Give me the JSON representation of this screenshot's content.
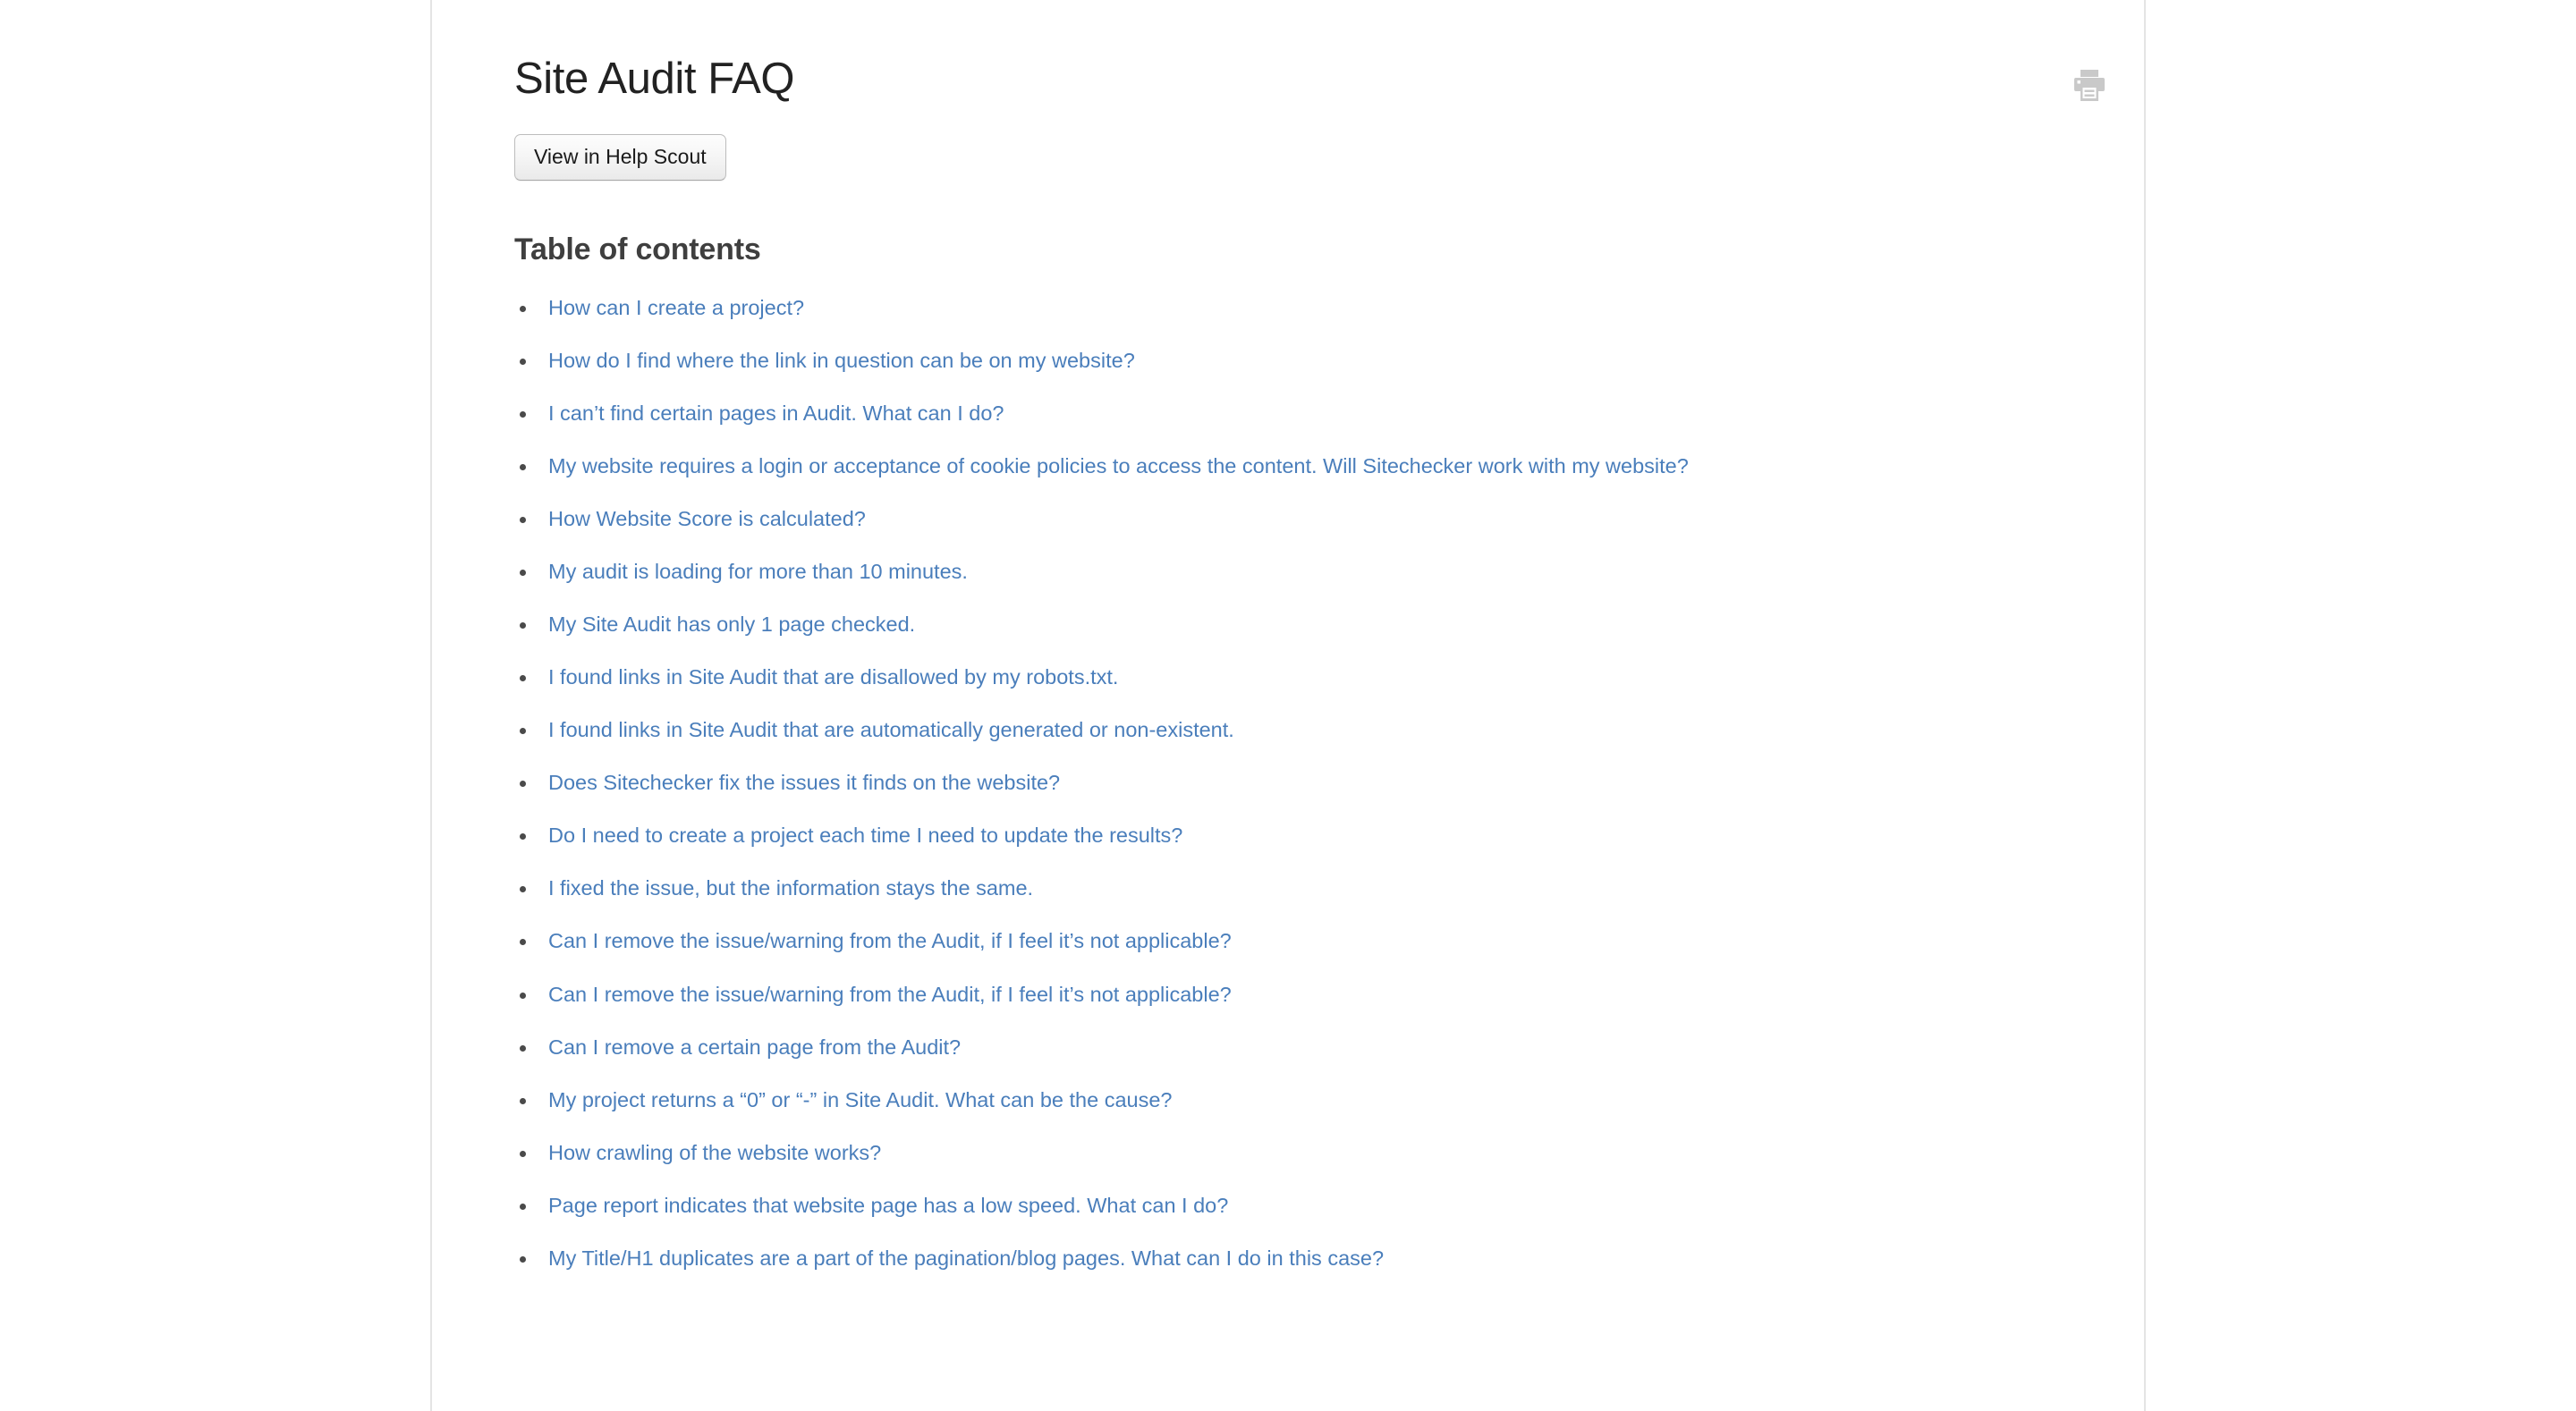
{
  "document": {
    "title": "Site Audit FAQ"
  },
  "toolbar": {
    "print_icon_name": "printer-icon",
    "print_icon_color": "#c9c9c9",
    "help_scout_button_label": "View in Help Scout"
  },
  "table_of_contents": {
    "heading": "Table of contents",
    "link_color": "#4a7ebb",
    "bullet_color": "#4a4a4a",
    "items": [
      {
        "label": "How can I create a project?"
      },
      {
        "label": "How do I find where the link in question can be on my website?"
      },
      {
        "label": "I can’t find certain pages in Audit. What can I do?"
      },
      {
        "label": "My website requires a login or acceptance of cookie policies to access the content. Will Sitechecker work with my website?"
      },
      {
        "label": "How Website Score is calculated?"
      },
      {
        "label": "My audit is loading for more than 10 minutes."
      },
      {
        "label": "My Site Audit has only 1 page checked."
      },
      {
        "label": "I found links in Site Audit that are disallowed by my robots.txt."
      },
      {
        "label": "I found links in Site Audit that are automatically generated or non-existent."
      },
      {
        "label": "Does Sitechecker fix the issues it finds on the website?"
      },
      {
        "label": "Do I need to create a project each time I need to update the results?"
      },
      {
        "label": "I fixed the issue, but the information stays the same."
      },
      {
        "label": "Can I remove the issue/warning from the Audit, if I feel it’s not applicable?"
      },
      {
        "label": "Can I remove the issue/warning from the Audit, if I feel it’s not applicable?"
      },
      {
        "label": "Can I remove a certain page from the Audit?"
      },
      {
        "label": "My project returns a “0” or “-” in Site Audit. What can be the cause?"
      },
      {
        "label": "How crawling of the website works?"
      },
      {
        "label": "Page report indicates that website page has a low speed. What can I do?"
      },
      {
        "label": "My Title/H1 duplicates are a part of the pagination/blog pages. What can I do in this case?"
      }
    ]
  }
}
